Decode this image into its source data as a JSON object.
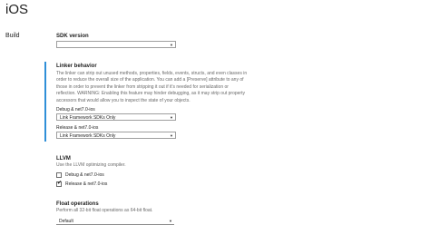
{
  "page": {
    "title": "iOS",
    "nav_label": "Build"
  },
  "sdk": {
    "title": "SDK version",
    "value": ""
  },
  "linker": {
    "title": "Linker behavior",
    "description_lines": [
      "The linker can strip out unused methods, properties, fields, events, structs, and even classes in",
      "order to reduce the overall size of the application. You can add a [Preserve] attribute to any of",
      "those in order to prevent the linker from stripping it out if it's needed for serialization or",
      "reflection. WARNING: Enabling this feature may hinder debugging, as it may strip out property",
      "accessors that would allow you to inspect the state of your objects."
    ],
    "debug_label": "Debug & net7.0-ios",
    "debug_value": "Link Framework SDKs Only",
    "release_label": "Release & net7.0-ios",
    "release_value": "Link Framework SDKs Only"
  },
  "llvm": {
    "title": "LLVM",
    "description": "Use the LLVM optimizing compiler.",
    "debug_label": "Debug & net7.0-ios",
    "debug_checked": false,
    "release_label": "Release & net7.0-ios",
    "release_checked": true
  },
  "float_ops": {
    "title": "Float operations",
    "description": "Perform all 32-bit float operations as 64-bit float.",
    "value": "Default"
  },
  "icons": {
    "chevron": "chevron-down-icon",
    "check": "checkmark-icon"
  },
  "colors": {
    "accent": "#2f8fd8"
  }
}
